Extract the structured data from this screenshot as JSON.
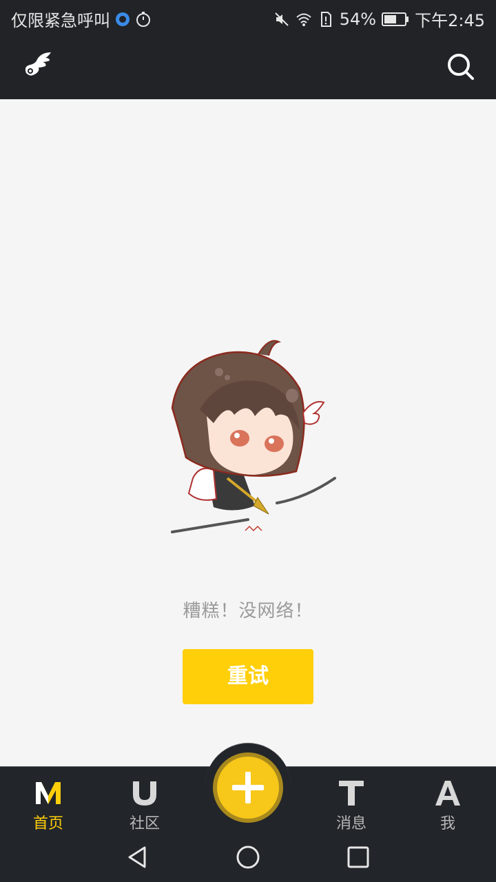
{
  "status_bar": {
    "carrier_text": "仅限紧急呼叫",
    "battery_percent": "54%",
    "time": "下午2:45",
    "icons": [
      "data-saver-icon",
      "timer-icon",
      "mute-icon",
      "wifi-icon",
      "sim-alert-icon",
      "battery-icon"
    ]
  },
  "header": {
    "logo_icon": "wing-logo-icon",
    "search_icon": "search-icon"
  },
  "main": {
    "error_message": "糟糕！没网络！",
    "retry_label": "重试"
  },
  "bottom_nav": {
    "items": [
      {
        "label": "首页",
        "icon": "m-logo-icon",
        "active": true
      },
      {
        "label": "社区",
        "icon": "u-logo-icon",
        "active": false
      },
      {
        "label": "消息",
        "icon": "t-logo-icon",
        "active": false
      },
      {
        "label": "我",
        "icon": "a-logo-icon",
        "active": false
      }
    ],
    "fab_icon": "plus-icon"
  },
  "system_nav": {
    "icons": [
      "back-icon",
      "home-icon",
      "recents-icon"
    ]
  },
  "colors": {
    "bar_bg": "#212327",
    "accent": "#ffcf0a",
    "page_bg": "#f5f5f5"
  }
}
